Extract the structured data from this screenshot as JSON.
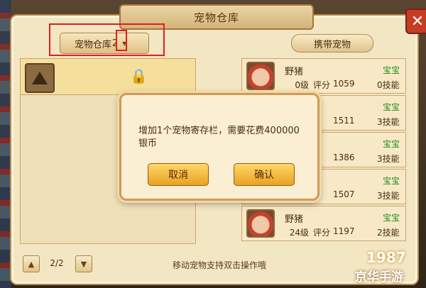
{
  "window": {
    "title": "宠物仓库",
    "close": "✕"
  },
  "storage": {
    "dropdown_label": "宠物仓库",
    "dropdown_number": "2",
    "chevron": "▾",
    "lock_glyph": "🔒",
    "pager": {
      "text": "2/2",
      "up": "▲",
      "down": "▼"
    }
  },
  "carry": {
    "label": "携带宠物"
  },
  "pets": [
    {
      "name": "野猪",
      "level": "0级",
      "score_label": "评分",
      "score": "1059",
      "type": "宝宝",
      "skills": "0技能"
    },
    {
      "name": "",
      "level": "",
      "score_label": "",
      "score": "1511",
      "type": "宝宝",
      "skills": "3技能"
    },
    {
      "name": "",
      "level": "",
      "score_label": "",
      "score": "1386",
      "type": "宝宝",
      "skills": "3技能"
    },
    {
      "name": "",
      "level": "",
      "score_label": "",
      "score": "1507",
      "type": "宝宝",
      "skills": "3技能"
    },
    {
      "name": "野猪",
      "level": "24级",
      "score_label": "评分",
      "score": "1197",
      "type": "宝宝",
      "skills": "2技能"
    }
  ],
  "hint": "移动宠物支持双击操作哦",
  "dialog": {
    "message": "增加1个宠物寄存栏，需要花费400000银币",
    "cancel_label": "取消",
    "confirm_label": "确认"
  },
  "watermark": {
    "top": "1987",
    "bottom": "京华手游"
  },
  "colors": {
    "highlight": "#e01e1e",
    "panel": "#f3e6c3",
    "button": "#e9a122",
    "green": "#1f8a1f",
    "close": "#c53c25"
  }
}
